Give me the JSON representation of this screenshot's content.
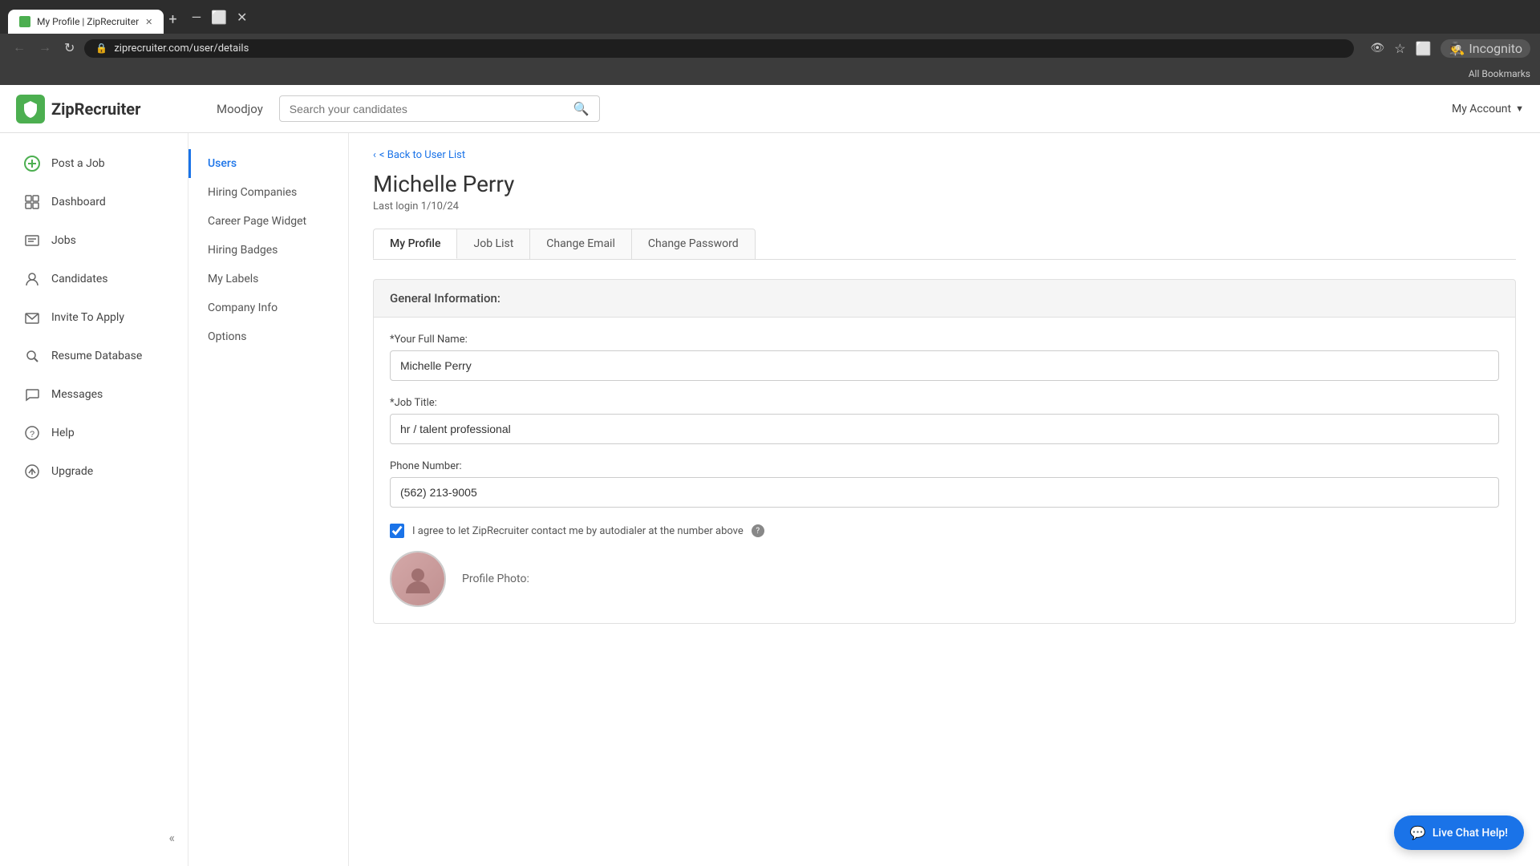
{
  "browser": {
    "tab_title": "My Profile | ZipRecruiter",
    "url": "ziprecruiter.com/user/details",
    "incognito_label": "Incognito",
    "bookmarks_label": "All Bookmarks"
  },
  "header": {
    "logo_text": "ZipRecruiter",
    "company_name": "Moodjoy",
    "search_placeholder": "Search your candidates",
    "my_account_label": "My Account"
  },
  "sidebar": {
    "items": [
      {
        "id": "post-a-job",
        "label": "Post a Job",
        "icon": "+"
      },
      {
        "id": "dashboard",
        "label": "Dashboard",
        "icon": "⊞"
      },
      {
        "id": "jobs",
        "label": "Jobs",
        "icon": "☰"
      },
      {
        "id": "candidates",
        "label": "Candidates",
        "icon": "👤"
      },
      {
        "id": "invite-to-apply",
        "label": "Invite To Apply",
        "icon": "✉"
      },
      {
        "id": "resume-database",
        "label": "Resume Database",
        "icon": "🔍"
      },
      {
        "id": "messages",
        "label": "Messages",
        "icon": "💬"
      },
      {
        "id": "help",
        "label": "Help",
        "icon": "?"
      },
      {
        "id": "upgrade",
        "label": "Upgrade",
        "icon": "⬆"
      }
    ]
  },
  "sub_nav": {
    "items": [
      {
        "id": "users",
        "label": "Users",
        "active": true
      },
      {
        "id": "hiring-companies",
        "label": "Hiring Companies"
      },
      {
        "id": "career-page-widget",
        "label": "Career Page Widget"
      },
      {
        "id": "hiring-badges",
        "label": "Hiring Badges"
      },
      {
        "id": "my-labels",
        "label": "My Labels"
      },
      {
        "id": "company-info",
        "label": "Company Info"
      },
      {
        "id": "options",
        "label": "Options"
      }
    ]
  },
  "main": {
    "back_link": "< Back to User List",
    "user_name": "Michelle Perry",
    "last_login": "Last login 1/10/24",
    "tabs": [
      {
        "id": "my-profile",
        "label": "My Profile",
        "active": true
      },
      {
        "id": "job-list",
        "label": "Job List"
      },
      {
        "id": "change-email",
        "label": "Change Email"
      },
      {
        "id": "change-password",
        "label": "Change Password"
      }
    ],
    "section_header": "General Information:",
    "form": {
      "full_name_label": "*Your Full Name:",
      "full_name_value": "Michelle Perry",
      "job_title_label": "*Job Title:",
      "job_title_value": "hr / talent professional",
      "phone_label": "Phone Number:",
      "phone_value": "(562) 213-9005",
      "autodialer_label": "I agree to let ZipRecruiter contact me by autodialer at the number above",
      "autodialer_checked": true,
      "profile_photo_label": "Profile Photo:"
    }
  },
  "live_chat": {
    "label": "Live Chat Help!"
  }
}
